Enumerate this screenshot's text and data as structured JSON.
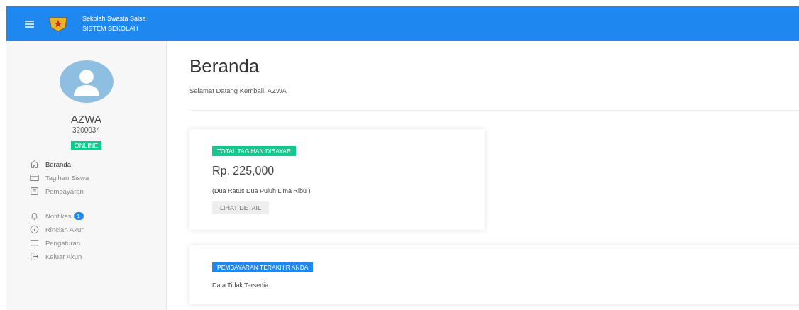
{
  "header": {
    "school_name": "Sekolah Swasta Salsa",
    "system_name": "SISTEM SEKOLAH"
  },
  "profile": {
    "name": "AZWA",
    "id": "3200034",
    "status": "ONLINE"
  },
  "menu_groups": [
    {
      "items": [
        {
          "label": "Beranda",
          "selected": true
        },
        {
          "label": "Tagihan Siswa",
          "selected": false
        },
        {
          "label": "Pembayaran",
          "selected": false
        }
      ]
    },
    {
      "items": [
        {
          "label": "Notifikasi",
          "selected": false,
          "badge": "1"
        },
        {
          "label": "Rincian Akun",
          "selected": false
        },
        {
          "label": "Pengaturan",
          "selected": false
        },
        {
          "label": "Keluar Akun",
          "selected": false
        }
      ]
    }
  ],
  "page": {
    "title": "Beranda",
    "subtitle": "Selamat Datang Kembali, AZWA"
  },
  "cards": [
    {
      "tag": "TOTAL TAGIHAN DIBAYAR",
      "color": "#10c98c",
      "amount": "Rp. 225,000",
      "note": "(Dua Ratus Dua Puluh Lima Ribu )",
      "button": "LIHAT DETAIL"
    },
    {
      "tag": "PEMBAYARAN TERAKHIR ANDA",
      "color": "#1e88f0",
      "note": "Data Tidak Tersedia"
    }
  ]
}
